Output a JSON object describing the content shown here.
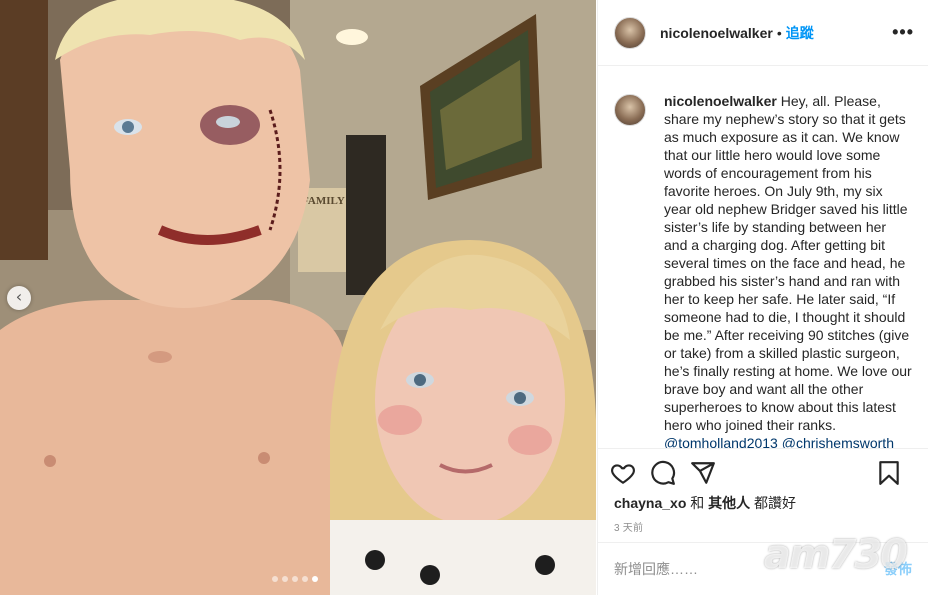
{
  "post": {
    "username": "nicolenoelwalker",
    "separator": "•",
    "follow_label": "追蹤",
    "more_label": "•••",
    "caption_user": "nicolenoelwalker",
    "caption_text": "Hey, all. Please, share my nephew’s story so that it gets as much exposure as it can. We know that our little hero would love some words of encouragement from his favorite heroes. On July 9th, my six year old nephew Bridger saved his little sister’s life by standing between her and a charging dog. After getting bit several times on the face and head, he grabbed his sister’s hand and ran with her to keep her safe. He later said, “If someone had to die, I thought it should be me.” After receiving 90 stitches (give or take) from a skilled plastic surgeon, he’s finally resting at home. We love our brave boy and want all the other superheroes to know about this latest hero who joined their ranks.",
    "caption_tags": "@tomholland2013 @chrishemsworth",
    "likes_user": "chayna_xo",
    "likes_suffix": "和",
    "likes_others": "其他人",
    "likes_end": "都讚好",
    "timestamp": "3 天前",
    "comment_placeholder": "新增回應……",
    "post_button": "發佈"
  },
  "carousel": {
    "prev_label": "‹",
    "dot_count": 5,
    "active_dot": 5
  },
  "photo": {
    "wall_sign": "FAMILY"
  },
  "watermark": "am730",
  "icons": [
    "heart-icon",
    "comment-icon",
    "share-icon",
    "bookmark-icon",
    "chevron-left-icon"
  ],
  "colors": {
    "link": "#0095f6",
    "tag": "#00376b",
    "muted": "#8e8e8e"
  }
}
